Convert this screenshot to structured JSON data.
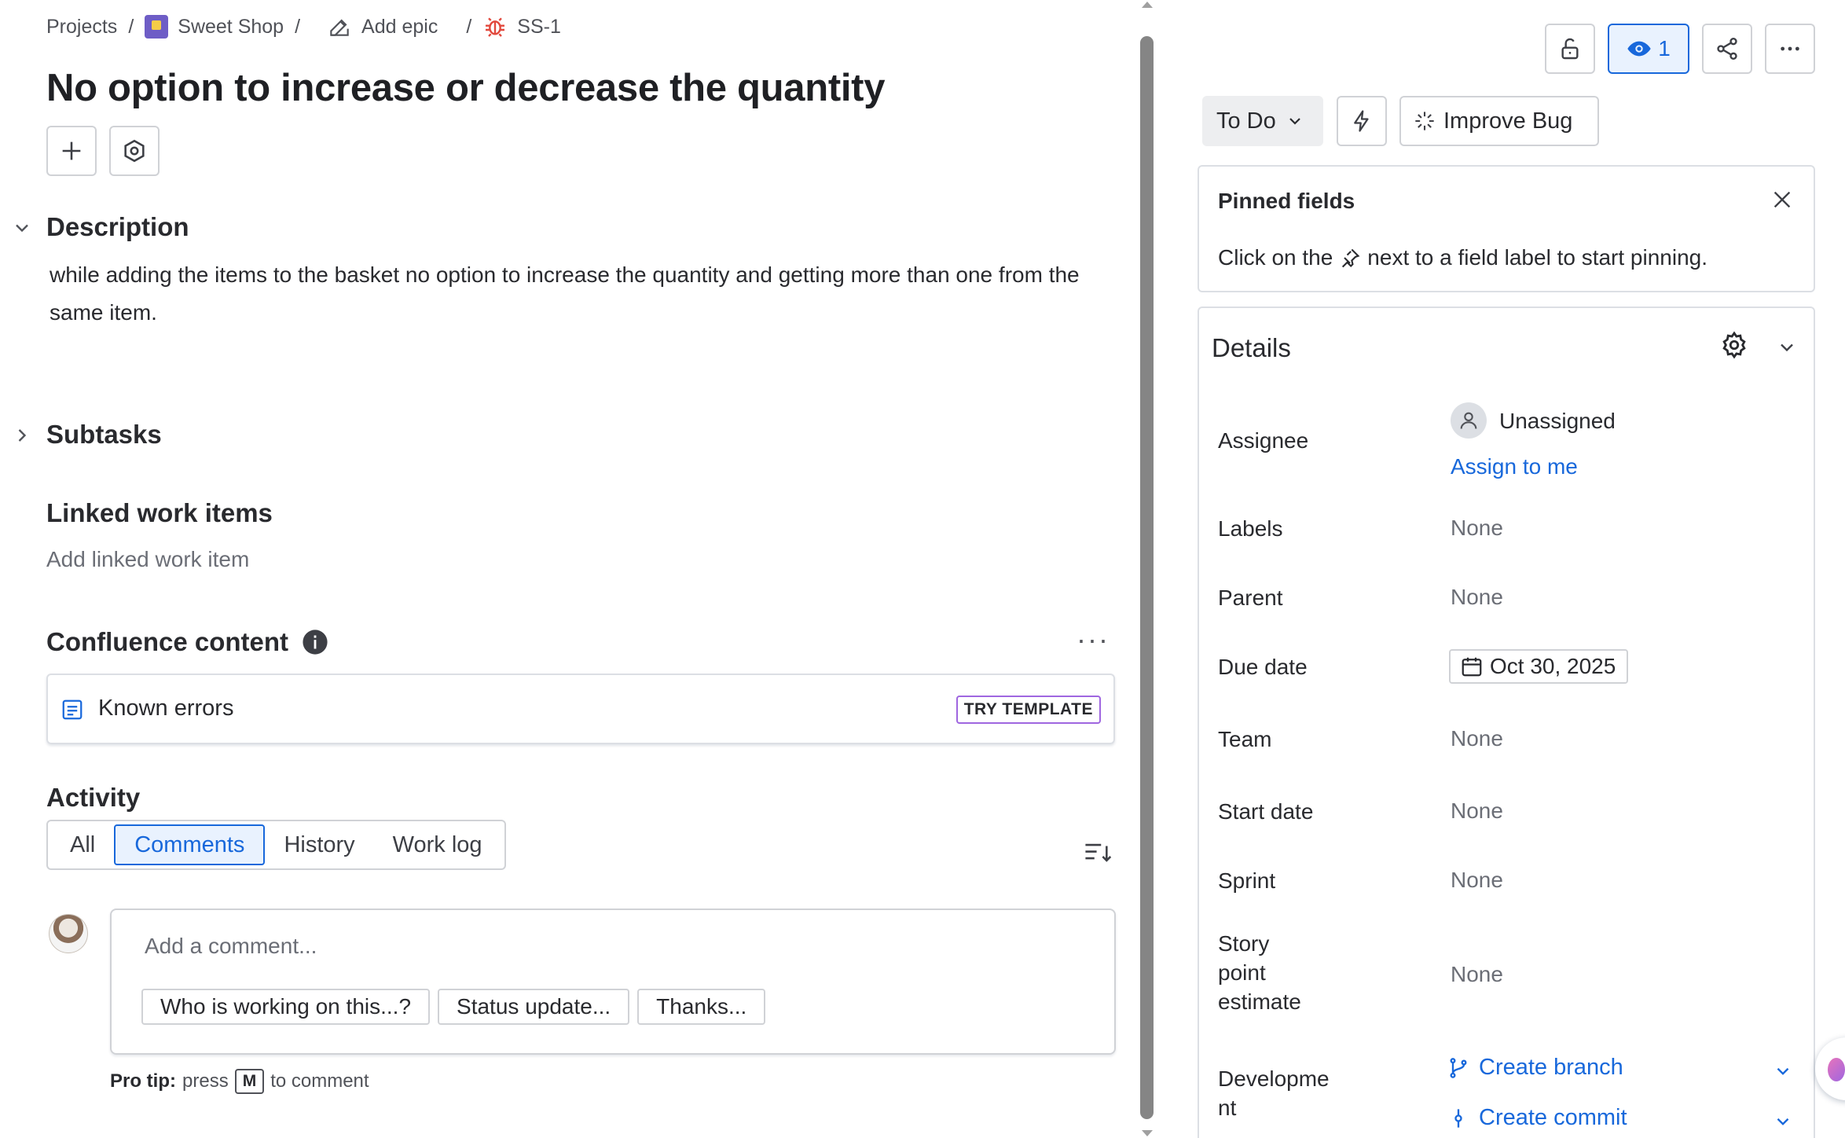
{
  "breadcrumbs": {
    "projects": "Projects",
    "project": "Sweet Shop",
    "epic": "Add epic",
    "key": "SS-1"
  },
  "issue": {
    "title": "No option to increase or decrease the quantity"
  },
  "description": {
    "heading": "Description",
    "text": "while adding the items to the basket no option to increase the quantity and getting more than one from the same item."
  },
  "subtasks": {
    "heading": "Subtasks"
  },
  "linked": {
    "heading": "Linked work items",
    "add_label": "Add linked work item"
  },
  "confluence": {
    "heading": "Confluence content",
    "item_label": "Known errors",
    "try_template": "TRY TEMPLATE"
  },
  "activity": {
    "heading": "Activity",
    "tabs": [
      "All",
      "Comments",
      "History",
      "Work log"
    ],
    "active_tab": "Comments"
  },
  "comment": {
    "placeholder": "Add a comment...",
    "suggestions": [
      "Who is working on this...?",
      "Status update...",
      "Thanks..."
    ],
    "protip_label": "Pro tip:",
    "protip_press": "press",
    "protip_key": "M",
    "protip_suffix": "to comment"
  },
  "toolbar": {
    "watchers_count": "1"
  },
  "status": {
    "label": "To Do",
    "improve_label": "Improve Bug"
  },
  "pinned": {
    "title": "Pinned fields",
    "text_before": "Click on the",
    "text_after": "next to a field label to start pinning."
  },
  "details": {
    "title": "Details",
    "fields": {
      "assignee_label": "Assignee",
      "assignee_value": "Unassigned",
      "assign_to_me": "Assign to me",
      "labels_label": "Labels",
      "labels_value": "None",
      "parent_label": "Parent",
      "parent_value": "None",
      "due_label": "Due date",
      "due_value": "Oct 30, 2025",
      "team_label": "Team",
      "team_value": "None",
      "start_label": "Start date",
      "start_value": "None",
      "sprint_label": "Sprint",
      "sprint_value": "None",
      "story_label_1": "Story",
      "story_label_2": "point",
      "story_label_3": "estimate",
      "story_value": "None",
      "dev_label_1": "Developme",
      "dev_label_2": "nt",
      "create_branch": "Create branch",
      "create_commit": "Create commit"
    }
  },
  "colors": {
    "accent": "#1868DB",
    "accent_bg": "#E9F2FE",
    "bug": "#E2483D",
    "project": "#6E5DC6"
  }
}
